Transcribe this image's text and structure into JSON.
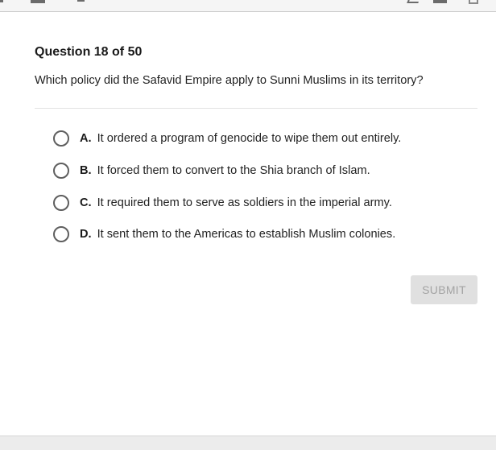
{
  "toolbar": {
    "icons": [
      "menu-icon",
      "tool-icon",
      "dash-icon",
      "text-to-speech-icon",
      "highlighter-icon",
      "window-icon"
    ]
  },
  "question": {
    "header": "Question 18 of 50",
    "prompt": "Which policy did the Safavid Empire apply to Sunni Muslims in its territory?"
  },
  "options": [
    {
      "letter": "A.",
      "text": "It ordered a program of genocide to wipe them out entirely."
    },
    {
      "letter": "B.",
      "text": "It forced them to convert to the Shia branch of Islam."
    },
    {
      "letter": "C.",
      "text": "It required them to serve as soldiers in the imperial army."
    },
    {
      "letter": "D.",
      "text": "It sent them to the Americas to establish Muslim colonies."
    }
  ],
  "submit_label": "SUBMIT",
  "colors": {
    "submit_bg": "#e0e0e0",
    "submit_text": "#a3a3a3",
    "radio_border": "#5f5f5f"
  }
}
